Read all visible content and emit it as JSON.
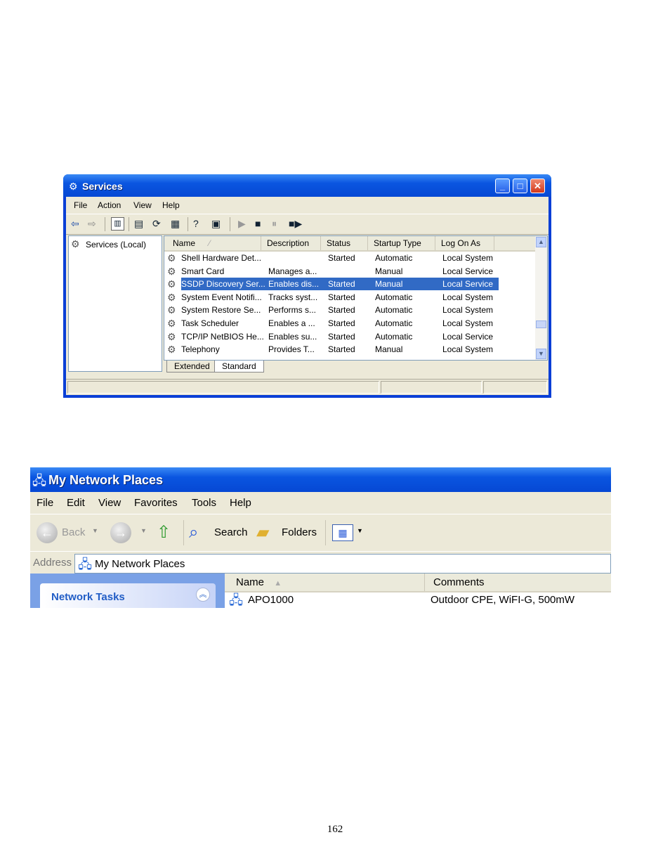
{
  "services_window": {
    "title": "Services",
    "menu": [
      "File",
      "Action",
      "View",
      "Help"
    ],
    "tree_node": "Services (Local)",
    "columns": [
      "Name",
      "Description",
      "Status",
      "Startup Type",
      "Log On As"
    ],
    "rows": [
      {
        "name": "Shell Hardware Det...",
        "description": "",
        "status": "Started",
        "startup": "Automatic",
        "logon": "Local System"
      },
      {
        "name": "Smart Card",
        "description": "Manages a...",
        "status": "",
        "startup": "Manual",
        "logon": "Local Service"
      },
      {
        "name": "SSDP Discovery Ser...",
        "description": "Enables dis...",
        "status": "Started",
        "startup": "Manual",
        "logon": "Local Service",
        "selected": true
      },
      {
        "name": "System Event Notifi...",
        "description": "Tracks syst...",
        "status": "Started",
        "startup": "Automatic",
        "logon": "Local System"
      },
      {
        "name": "System Restore Se...",
        "description": "Performs s...",
        "status": "Started",
        "startup": "Automatic",
        "logon": "Local System"
      },
      {
        "name": "Task Scheduler",
        "description": "Enables a ...",
        "status": "Started",
        "startup": "Automatic",
        "logon": "Local System"
      },
      {
        "name": "TCP/IP NetBIOS He...",
        "description": "Enables su...",
        "status": "Started",
        "startup": "Automatic",
        "logon": "Local Service"
      },
      {
        "name": "Telephony",
        "description": "Provides T...",
        "status": "Started",
        "startup": "Manual",
        "logon": "Local System"
      }
    ],
    "tabs": [
      "Extended",
      "Standard"
    ]
  },
  "network_window": {
    "title": "My Network Places",
    "menu": [
      "File",
      "Edit",
      "View",
      "Favorites",
      "Tools",
      "Help"
    ],
    "toolbar": {
      "back": "Back",
      "search": "Search",
      "folders": "Folders"
    },
    "address_label": "Address",
    "address_value": "My Network Places",
    "task_header": "Network Tasks",
    "columns": [
      "Name",
      "Comments"
    ],
    "item": {
      "name": "APO1000",
      "comment": "Outdoor CPE, WiFI-G, 500mW"
    }
  },
  "page_number": "162",
  "colors": {
    "title_blue": "#0a55e0",
    "selection": "#316ac5",
    "face": "#ece9d8"
  }
}
